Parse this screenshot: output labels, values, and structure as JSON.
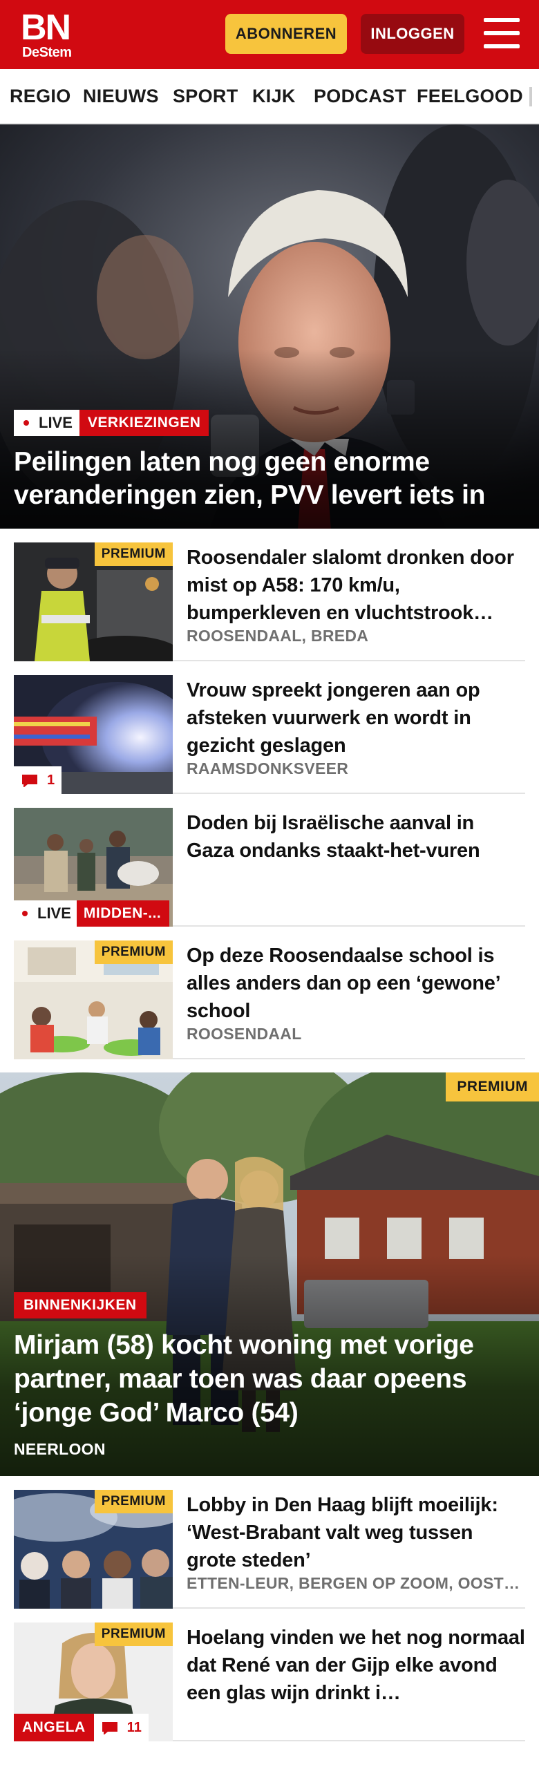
{
  "header": {
    "logo_main": "BN",
    "logo_sub": "DeStem",
    "subscribe_label": "ABONNEREN",
    "login_label": "INLOGGEN"
  },
  "nav": {
    "items": [
      "REGIO",
      "NIEUWS",
      "SPORT",
      "KIJK",
      "PODCAST",
      "FEELGOOD"
    ]
  },
  "hero": {
    "live_label": "LIVE",
    "category": "VERKIEZINGEN",
    "title": "Peilingen laten nog geen enorme veranderingen zien, PVV levert iets in"
  },
  "articles": [
    {
      "badge": "PREMIUM",
      "title": "Roosendaler slalomt dronken door mist op A58: 170 km/u, bumperkleven en vluchtstrook…",
      "meta": "ROOSENDAAL, BREDA"
    },
    {
      "comments": "1",
      "title": "Vrouw spreekt jongeren aan op afsteken vuurwerk en wordt in gezicht geslagen",
      "meta": "RAAMSDONKSVEER"
    },
    {
      "live_label": "LIVE",
      "category": "MIDDEN-...",
      "title": "Doden bij Israëlische aanval in Gaza ondanks staakt-het-vuren"
    },
    {
      "badge": "PREMIUM",
      "title": "Op deze Roosendaalse school is alles anders dan op een ‘gewone’ school",
      "meta": "ROOSENDAAL"
    }
  ],
  "feature": {
    "badge": "PREMIUM",
    "category": "BINNENKIJKEN",
    "title": "Mirjam (58) kocht woning met vorige partner, maar toen was daar opeens ‘jonge God’ Marco (54)",
    "meta": "NEERLOON"
  },
  "articles2": [
    {
      "badge": "PREMIUM",
      "title": "Lobby in Den Haag blijft moeilijk: ‘West-Brabant valt weg tussen grote steden’",
      "meta": "ETTEN-LEUR, BERGEN OP ZOOM, OOSTERHOUT"
    },
    {
      "badge": "PREMIUM",
      "author": "ANGELA",
      "comments": "11",
      "title": "Hoelang vinden we het nog normaal dat René van der Gijp elke avond een glas wijn drinkt i…"
    }
  ],
  "colors": {
    "brand_red": "#d10a11",
    "dark_red": "#970a10",
    "premium_yellow": "#f7c43d"
  }
}
